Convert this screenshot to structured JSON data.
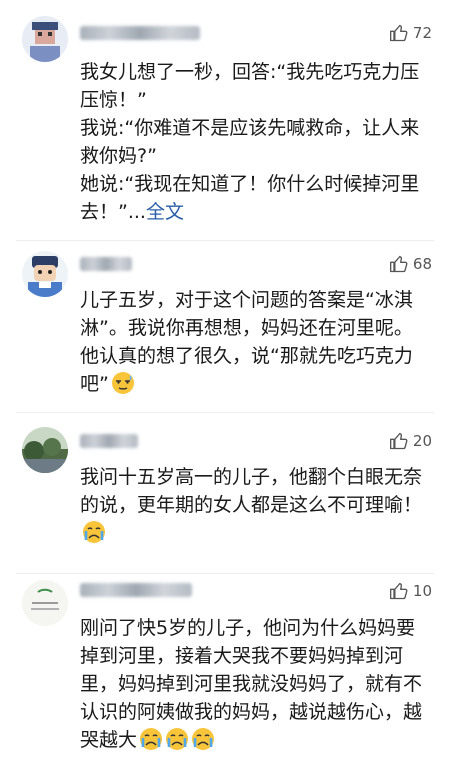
{
  "comments": [
    {
      "likes": "72",
      "lines": [
        "我女儿想了一秒，回答:“我先吃巧克力压压惊！”",
        "我说:“你难道不是应该先喊救命，让人来救你妈?”",
        "她说:“我现在知道了！你什么时候掉河里去！”..."
      ],
      "more_label": "全文",
      "avatar": "pixel-avatar"
    },
    {
      "likes": "68",
      "text": "儿子五岁，对于这个问题的答案是“冰淇淋”。我说你再想想，妈妈还在河里呢。他认真的想了很久，说“那就先吃巧克力吧”",
      "emoji": "awkward-smile-emoji",
      "avatar": "cartoon-boy-avatar"
    },
    {
      "likes": "20",
      "text": "我问十五岁高一的儿子，他翻个白眼无奈的说，更年期的女人都是这么不可理喻！",
      "emoji": "crying-emoji",
      "avatar": "landscape-photo-avatar"
    },
    {
      "likes": "10",
      "text": "刚问了快5岁的儿子，他问为什么妈妈要掉到河里，接着大哭我不要妈妈掉到河里，妈妈掉到河里我就没妈妈了，就有不认识的阿姨做我的妈妈，越说越伤心，越哭越大",
      "emoji_count": 3,
      "emoji": "crying-emoji",
      "avatar": "handwriting-avatar"
    }
  ],
  "colors": {
    "link": "#2a5ea8",
    "text": "#1a1a1a",
    "likes": "#555555"
  },
  "icons": {
    "like": "thumbs-up-icon"
  }
}
